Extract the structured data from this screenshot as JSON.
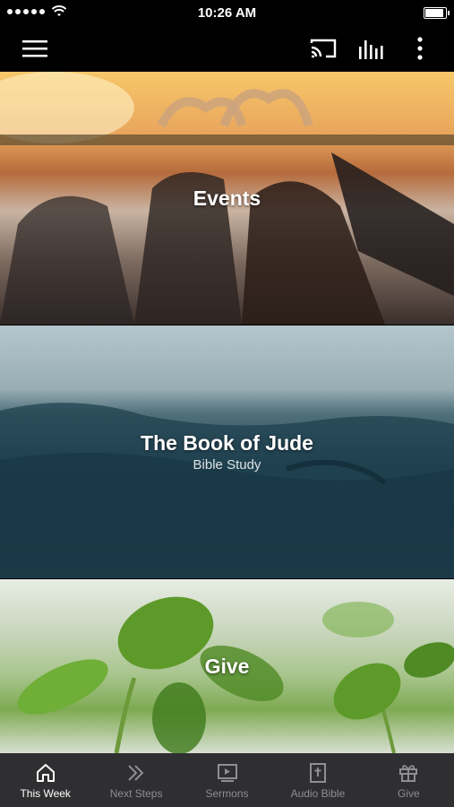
{
  "status_bar": {
    "time": "10:26 AM"
  },
  "app_bar": {
    "icons": [
      "menu-icon",
      "cast-icon",
      "audio-bars-icon",
      "more-vert-icon"
    ]
  },
  "cards": [
    {
      "title": "Events",
      "subtitle": ""
    },
    {
      "title": "The Book of Jude",
      "subtitle": "Bible Study"
    },
    {
      "title": "Give",
      "subtitle": ""
    }
  ],
  "tabs": [
    {
      "label": "This Week",
      "icon": "home-icon",
      "active": true
    },
    {
      "label": "Next Steps",
      "icon": "double-chevron-icon",
      "active": false
    },
    {
      "label": "Sermons",
      "icon": "video-play-icon",
      "active": false
    },
    {
      "label": "Audio Bible",
      "icon": "bible-icon",
      "active": false
    },
    {
      "label": "Give",
      "icon": "gift-icon",
      "active": false
    }
  ],
  "colors": {
    "tab_active": "#ffffff",
    "tab_inactive": "#8e8e93",
    "tab_bar_bg": "#2f2f31",
    "app_bar_bg": "#000000"
  }
}
